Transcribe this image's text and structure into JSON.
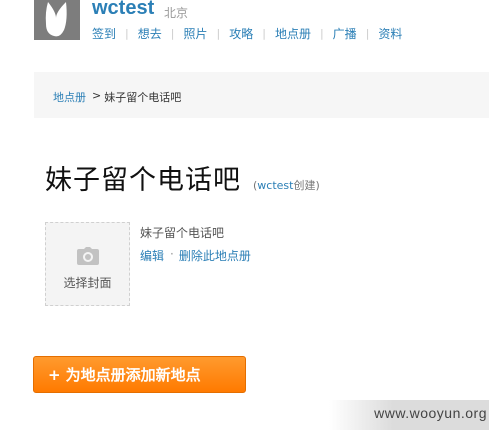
{
  "header": {
    "username": "wctest",
    "city": "北京",
    "nav": [
      {
        "label": "签到"
      },
      {
        "label": "想去"
      },
      {
        "label": "照片"
      },
      {
        "label": "攻略"
      },
      {
        "label": "地点册"
      },
      {
        "label": "广播"
      },
      {
        "label": "资料"
      }
    ]
  },
  "breadcrumb": {
    "parent": "地点册",
    "arrow": ">",
    "current": "妹子留个电话吧"
  },
  "album": {
    "title": "妹子留个电话吧",
    "creator_open": "(",
    "creator_user": "wctest",
    "creator_suffix": "创建)",
    "cover_label": "选择封面",
    "info_title": "妹子留个电话吧",
    "edit_label": "编辑",
    "dot": "·",
    "delete_label": "删除此地点册"
  },
  "actions": {
    "add_plus": "+",
    "add_label": "为地点册添加新地点"
  },
  "watermark": {
    "text": "www.wooyun.org"
  },
  "colors": {
    "link": "#2b7fb6",
    "button": "#ff8000"
  }
}
